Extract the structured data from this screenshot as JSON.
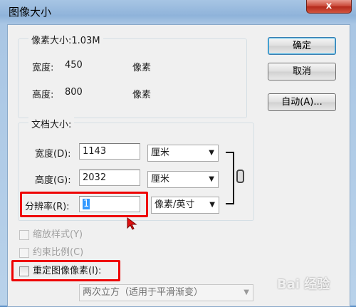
{
  "window": {
    "title": "图像大小",
    "close_label": "x"
  },
  "pixel_dimensions": {
    "legend": "像素大小:1.03M",
    "width_label": "宽度:",
    "width_value": "450",
    "width_unit": "像素",
    "height_label": "高度:",
    "height_value": "800",
    "height_unit": "像素"
  },
  "document_size": {
    "legend": "文档大小:",
    "width_label": "宽度(D):",
    "width_value": "1143",
    "width_unit": "厘米",
    "height_label": "高度(G):",
    "height_value": "2032",
    "height_unit": "厘米",
    "resolution_label": "分辨率(R):",
    "resolution_value": "1",
    "resolution_unit": "像素/英寸"
  },
  "options": {
    "scale_styles": "缩放样式(Y)",
    "constrain_proportions": "约束比例(C)",
    "resample": "重定图像像素(I):",
    "resample_method": "两次立方（适用于平滑渐变）"
  },
  "buttons": {
    "ok": "确定",
    "cancel": "取消",
    "auto": "自动(A)..."
  },
  "watermark": "Bai 经验"
}
